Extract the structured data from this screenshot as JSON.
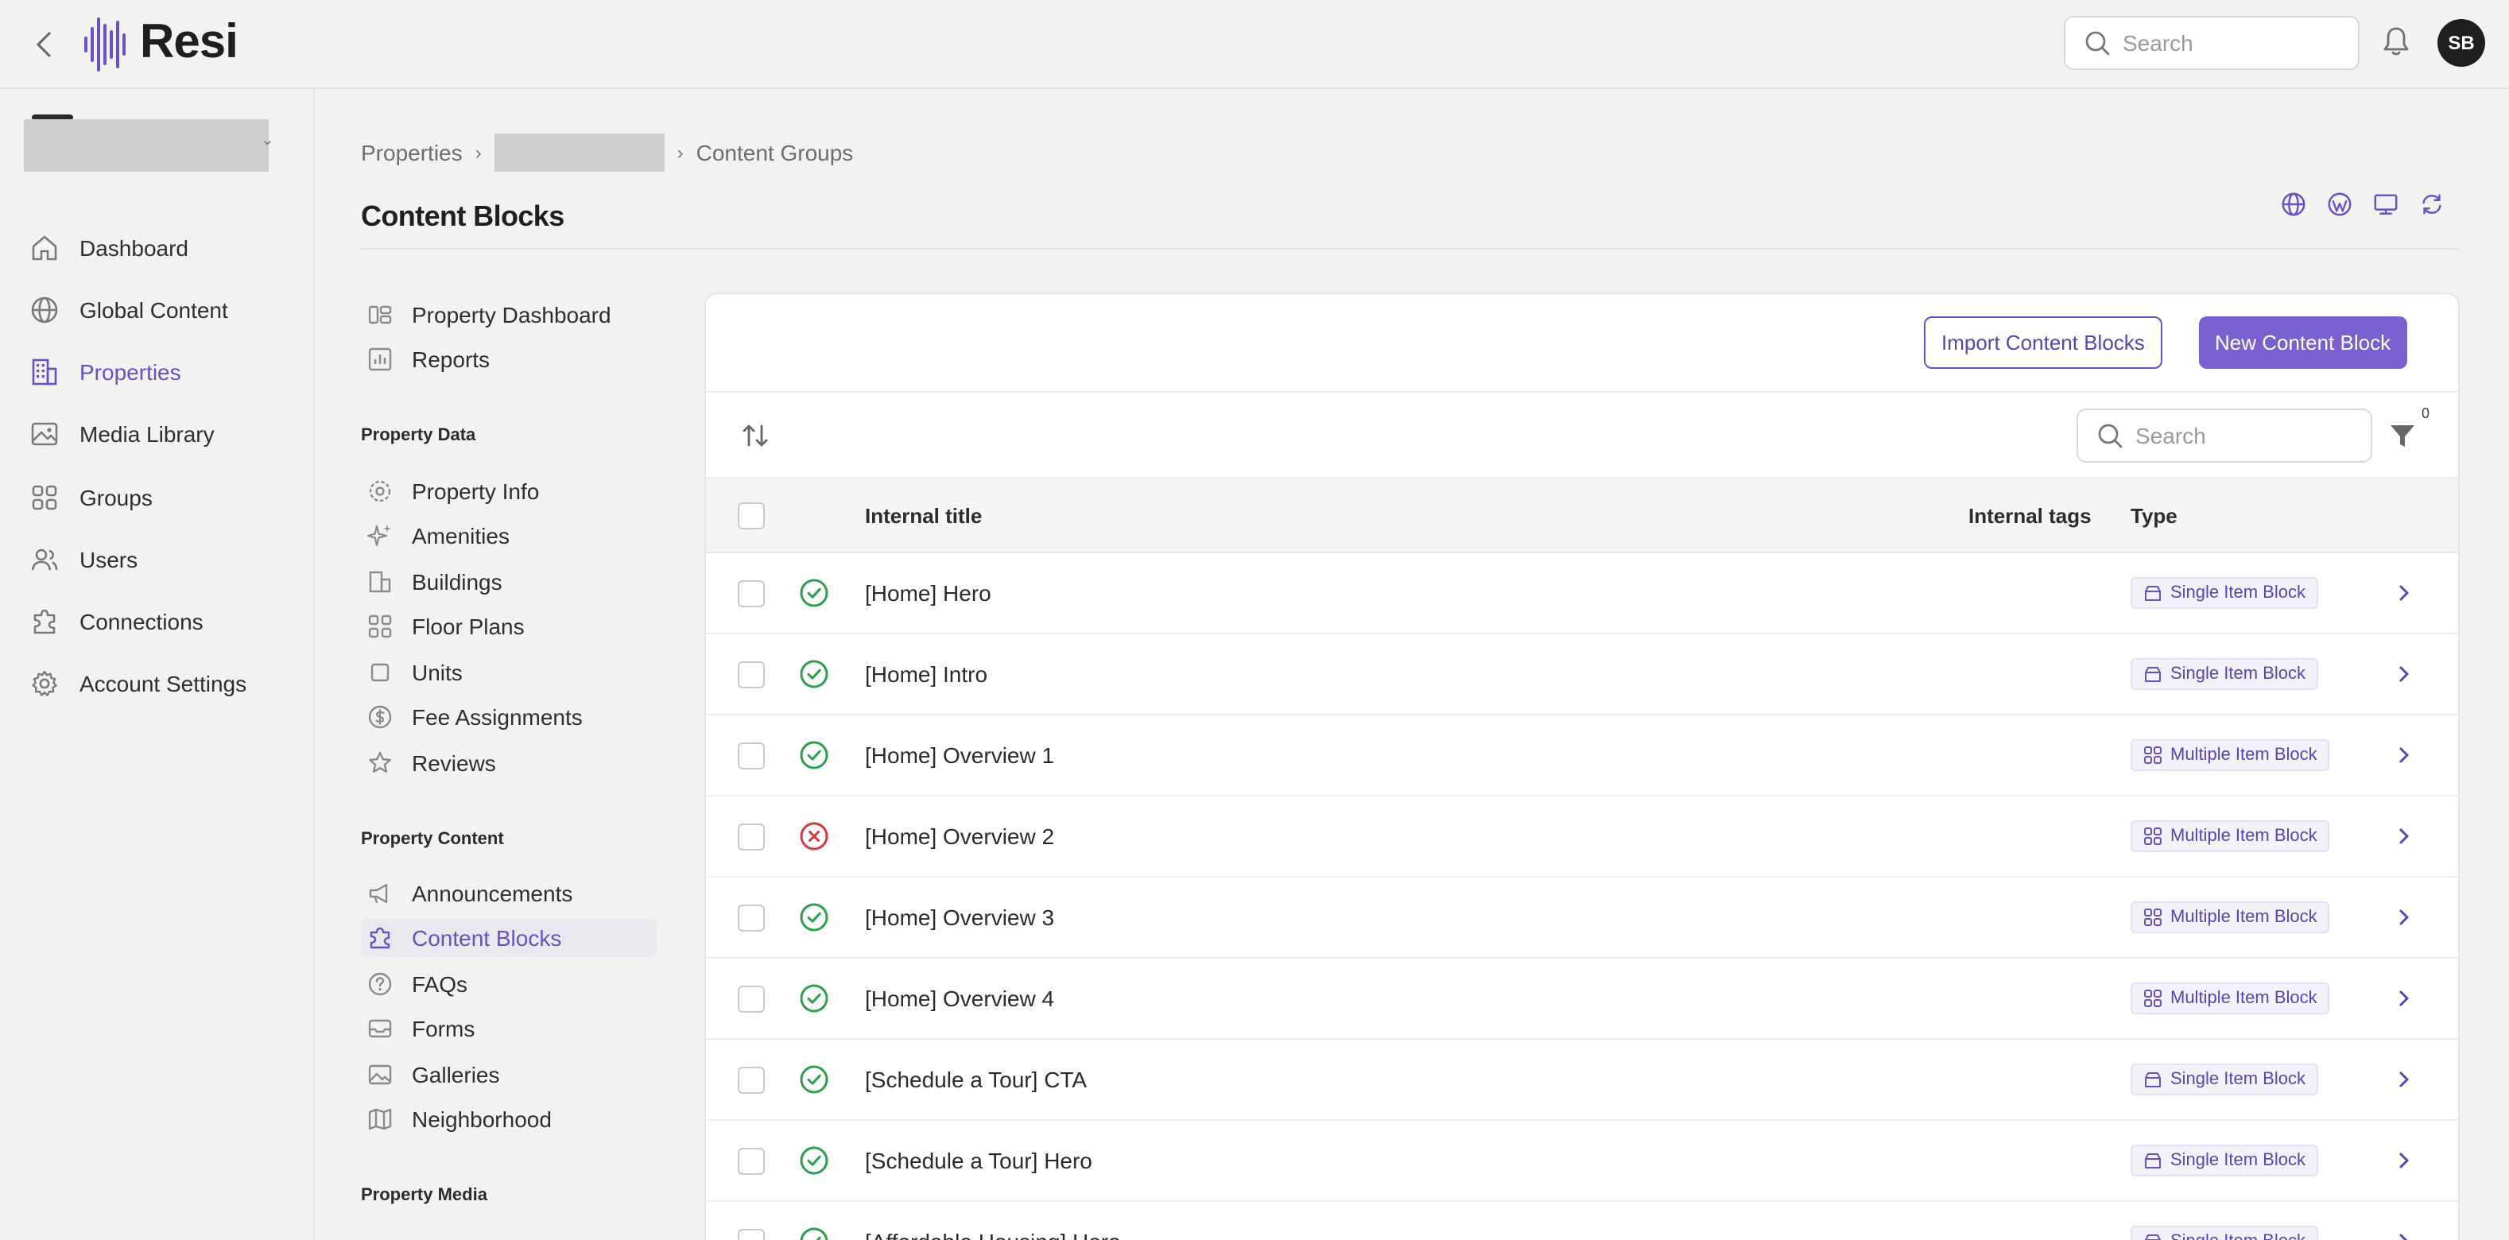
{
  "app": {
    "logo_text": "Resi",
    "avatar_initials": "SB"
  },
  "header": {
    "search_placeholder": "Search"
  },
  "leftnav": {
    "items": [
      {
        "label": "Dashboard",
        "icon": "home-icon"
      },
      {
        "label": "Global Content",
        "icon": "globe-icon"
      },
      {
        "label": "Properties",
        "icon": "building-icon"
      },
      {
        "label": "Media Library",
        "icon": "image-icon"
      },
      {
        "label": "Groups",
        "icon": "grid-icon"
      },
      {
        "label": "Users",
        "icon": "users-icon"
      },
      {
        "label": "Connections",
        "icon": "puzzle-icon"
      },
      {
        "label": "Account Settings",
        "icon": "gear-icon"
      }
    ],
    "active_index": 2
  },
  "breadcrumb": {
    "first": "Properties",
    "last": "Content Groups"
  },
  "page": {
    "title": "Content Blocks"
  },
  "subnav": {
    "top_items": [
      {
        "label": "Property Dashboard"
      },
      {
        "label": "Reports"
      }
    ],
    "property_data_heading": "Property Data",
    "property_data_items": [
      {
        "label": "Property Info"
      },
      {
        "label": "Amenities"
      },
      {
        "label": "Buildings"
      },
      {
        "label": "Floor Plans"
      },
      {
        "label": "Units"
      },
      {
        "label": "Fee Assignments"
      },
      {
        "label": "Reviews"
      }
    ],
    "property_content_heading": "Property Content",
    "property_content_items": [
      {
        "label": "Announcements"
      },
      {
        "label": "Content Blocks"
      },
      {
        "label": "FAQs"
      },
      {
        "label": "Forms"
      },
      {
        "label": "Galleries"
      },
      {
        "label": "Neighborhood"
      }
    ],
    "property_media_heading": "Property Media"
  },
  "card": {
    "import_button": "Import Content Blocks",
    "new_button": "New Content Block",
    "search_placeholder": "Search",
    "filter_count": "0",
    "columns": {
      "title": "Internal title",
      "tags": "Internal tags",
      "type": "Type"
    },
    "rows": [
      {
        "title": "[Home] Hero",
        "status": "published",
        "type": "Single Item Block"
      },
      {
        "title": "[Home] Intro",
        "status": "published",
        "type": "Single Item Block"
      },
      {
        "title": "[Home] Overview 1",
        "status": "published",
        "type": "Multiple Item Block"
      },
      {
        "title": "[Home] Overview 2",
        "status": "unpublished",
        "type": "Multiple Item Block"
      },
      {
        "title": "[Home] Overview 3",
        "status": "published",
        "type": "Multiple Item Block"
      },
      {
        "title": "[Home] Overview 4",
        "status": "published",
        "type": "Multiple Item Block"
      },
      {
        "title": "[Schedule a Tour] CTA",
        "status": "published",
        "type": "Single Item Block"
      },
      {
        "title": "[Schedule a Tour] Hero",
        "status": "published",
        "type": "Single Item Block"
      },
      {
        "title": "[Affordable Housing] Hero",
        "status": "published",
        "type": "Single Item Block"
      }
    ]
  },
  "colors": {
    "accent": "#6a4fc7",
    "success": "#2e9e4f",
    "error": "#d63a3a"
  }
}
